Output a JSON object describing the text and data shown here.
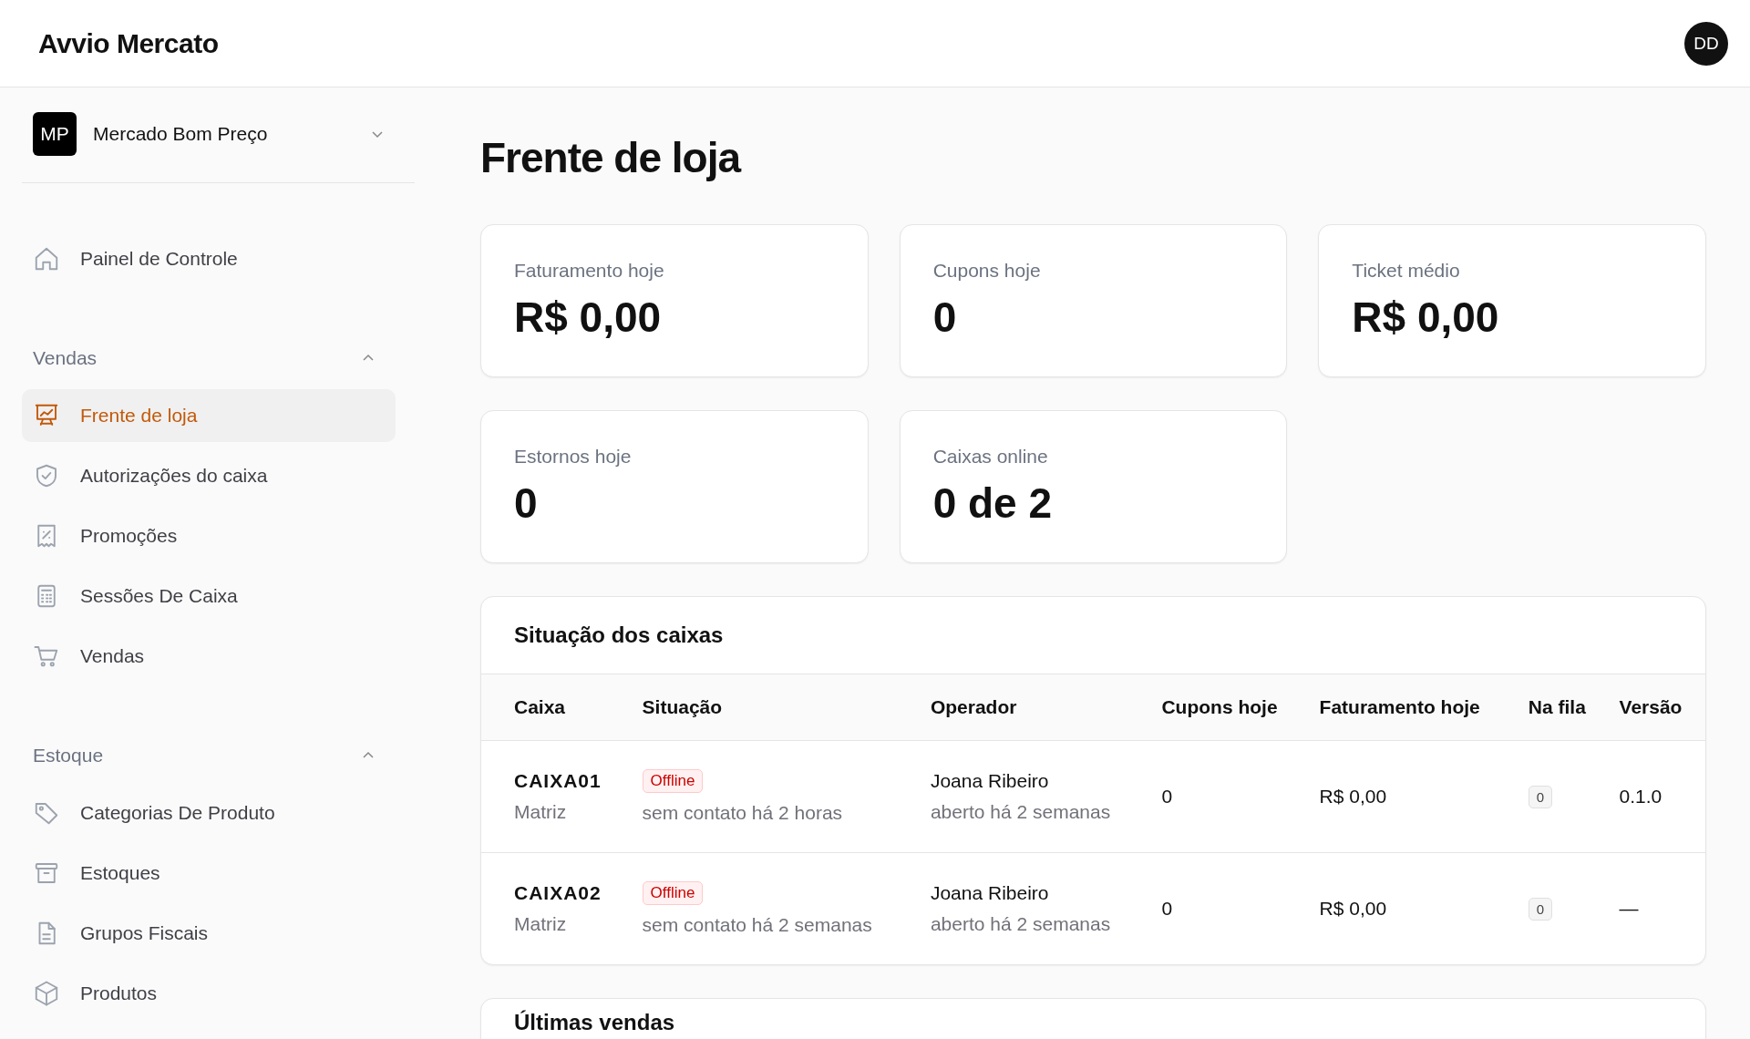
{
  "app": {
    "title": "Avvio Mercato",
    "avatar": "DD"
  },
  "sidebar": {
    "store": {
      "initials": "MP",
      "name": "Mercado Bom Preço"
    },
    "top_items": [
      {
        "label": "Painel de Controle",
        "selected": false
      }
    ],
    "sections": [
      {
        "title": "Vendas",
        "expanded": true,
        "items": [
          {
            "label": "Frente de loja",
            "selected": true
          },
          {
            "label": "Autorizações do caixa",
            "selected": false
          },
          {
            "label": "Promoções",
            "selected": false
          },
          {
            "label": "Sessões De Caixa",
            "selected": false
          },
          {
            "label": "Vendas",
            "selected": false
          }
        ]
      },
      {
        "title": "Estoque",
        "expanded": true,
        "items": [
          {
            "label": "Categorias De Produto",
            "selected": false
          },
          {
            "label": "Estoques",
            "selected": false
          },
          {
            "label": "Grupos Fiscais",
            "selected": false
          },
          {
            "label": "Produtos",
            "selected": false
          }
        ]
      }
    ]
  },
  "page": {
    "title": "Frente de loja",
    "stats": [
      {
        "label": "Faturamento hoje",
        "value": "R$ 0,00"
      },
      {
        "label": "Cupons hoje",
        "value": "0"
      },
      {
        "label": "Ticket médio",
        "value": "R$ 0,00"
      },
      {
        "label": "Estornos hoje",
        "value": "0"
      },
      {
        "label": "Caixas online",
        "value": "0 de 2"
      }
    ],
    "registers": {
      "title": "Situação dos caixas",
      "columns": [
        "Caixa",
        "Situação",
        "Operador",
        "Cupons hoje",
        "Faturamento hoje",
        "Na fila",
        "Versão"
      ],
      "rows": [
        {
          "code": "CAIXA01",
          "location": "Matriz",
          "status": "Offline",
          "status_detail": "sem contato há 2 horas",
          "operator": "Joana Ribeiro",
          "operator_detail": "aberto há 2 semanas",
          "coupons": "0",
          "revenue": "R$ 0,00",
          "queue": "0",
          "version": "0.1.0"
        },
        {
          "code": "CAIXA02",
          "location": "Matriz",
          "status": "Offline",
          "status_detail": "sem contato há 2 semanas",
          "operator": "Joana Ribeiro",
          "operator_detail": "aberto há 2 semanas",
          "coupons": "0",
          "revenue": "R$ 0,00",
          "queue": "0",
          "version": "—"
        }
      ]
    },
    "recent_sales": {
      "title": "Últimas vendas"
    }
  }
}
